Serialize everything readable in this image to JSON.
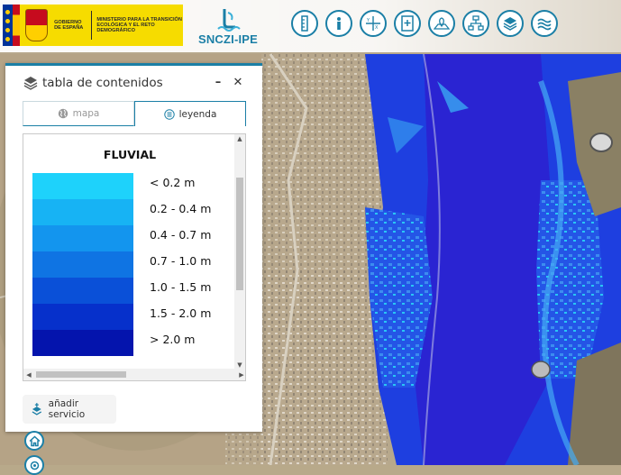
{
  "header": {
    "gov_left": "GOBIERNO DE ESPAÑA",
    "gov_right": "MINISTERIO PARA LA TRANSICIÓN ECOLÓGICA Y EL RETO DEMOGRÁFICO",
    "app_name": "SNCZI-IPE"
  },
  "toolbar": [
    {
      "name": "ruler-icon"
    },
    {
      "name": "info-icon"
    },
    {
      "name": "coordinates-icon"
    },
    {
      "name": "bookmark-icon"
    },
    {
      "name": "location-map-icon"
    },
    {
      "name": "sitemap-icon"
    },
    {
      "name": "layers-icon"
    },
    {
      "name": "waves-icon"
    }
  ],
  "panel": {
    "title": "tabla de contenidos",
    "minimize": "–",
    "close": "✕",
    "tabs": [
      {
        "label": "mapa",
        "icon": "globe-icon",
        "active": false
      },
      {
        "label": "leyenda",
        "icon": "list-icon",
        "active": true
      }
    ],
    "legend": {
      "title": "FLUVIAL",
      "items": [
        {
          "label": "< 0.2 m",
          "color": "#1ed2fb"
        },
        {
          "label": "0.2 - 0.4 m",
          "color": "#17b3f4"
        },
        {
          "label": "0.4 - 0.7 m",
          "color": "#1395ee"
        },
        {
          "label": "0.7 - 1.0 m",
          "color": "#0f74e3"
        },
        {
          "label": "1.0 - 1.5 m",
          "color": "#0a50d8"
        },
        {
          "label": "1.5 - 2.0 m",
          "color": "#0630cb"
        },
        {
          "label": "> 2.0 m",
          "color": "#0414ad"
        }
      ]
    },
    "add_service": "añadir servicio"
  },
  "side_buttons": [
    {
      "name": "home-icon"
    },
    {
      "name": "locate-icon"
    }
  ],
  "colors": {
    "accent": "#1b7fa6",
    "flood_deep": "#1a1fd6",
    "flood_shallow": "#27b6f0"
  }
}
